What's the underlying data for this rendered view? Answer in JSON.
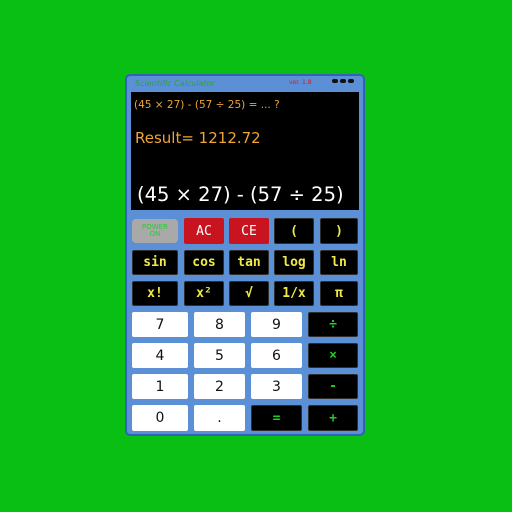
{
  "app": {
    "title": "Scientific Calculator",
    "version": "ver. 1.8"
  },
  "display": {
    "question": "(45 × 27) - (57 ÷ 25) = ... ?",
    "result": "Result= 1212.72",
    "expression": "(45 × 27) - (57 ÷ 25)"
  },
  "keys": {
    "power_line1": "POWER",
    "power_line2": "ON",
    "ac": "AC",
    "ce": "CE",
    "paren_open": "(",
    "paren_close": ")",
    "sin": "sin",
    "cos": "cos",
    "tan": "tan",
    "log": "log",
    "ln": "ln",
    "factorial": "x!",
    "square": "x²",
    "sqrt": "√",
    "reciprocal": "1/x",
    "pi": "π",
    "d7": "7",
    "d8": "8",
    "d9": "9",
    "divide": "÷",
    "d4": "4",
    "d5": "5",
    "d6": "6",
    "multiply": "×",
    "d1": "1",
    "d2": "2",
    "d3": "3",
    "minus": "-",
    "d0": "0",
    "decimal": ".",
    "equals": "=",
    "plus": "+"
  },
  "colors": {
    "background": "#0abf13",
    "body": "#5b8fd6",
    "display_text": "#f0a436",
    "function_key_text": "#f0e94a",
    "operator_text": "#1fd023",
    "clear_key": "#c8141f"
  }
}
